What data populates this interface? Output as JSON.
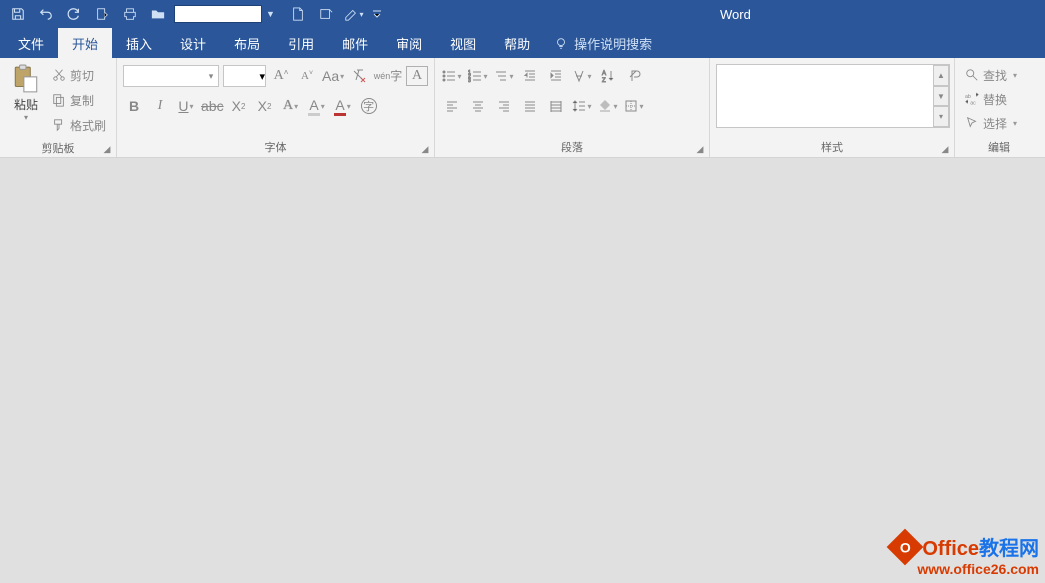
{
  "app_title": "Word",
  "qat": {
    "combo_value": ""
  },
  "tabs": {
    "file": "文件",
    "home": "开始",
    "insert": "插入",
    "design": "设计",
    "layout": "布局",
    "references": "引用",
    "mailings": "邮件",
    "review": "审阅",
    "view": "视图",
    "help": "帮助"
  },
  "tell_me": "操作说明搜索",
  "groups": {
    "clipboard": {
      "label": "剪贴板",
      "paste": "粘贴",
      "cut": "剪切",
      "copy": "复制",
      "format_painter": "格式刷"
    },
    "font": {
      "label": "字体",
      "font_name": "",
      "font_size": ""
    },
    "paragraph": {
      "label": "段落"
    },
    "styles": {
      "label": "样式"
    },
    "editing": {
      "label": "编辑",
      "find": "查找",
      "replace": "替换",
      "select": "选择"
    }
  },
  "watermark": {
    "line1_a": "Office",
    "line1_b": "教程网",
    "line2": "www.office26.com"
  }
}
